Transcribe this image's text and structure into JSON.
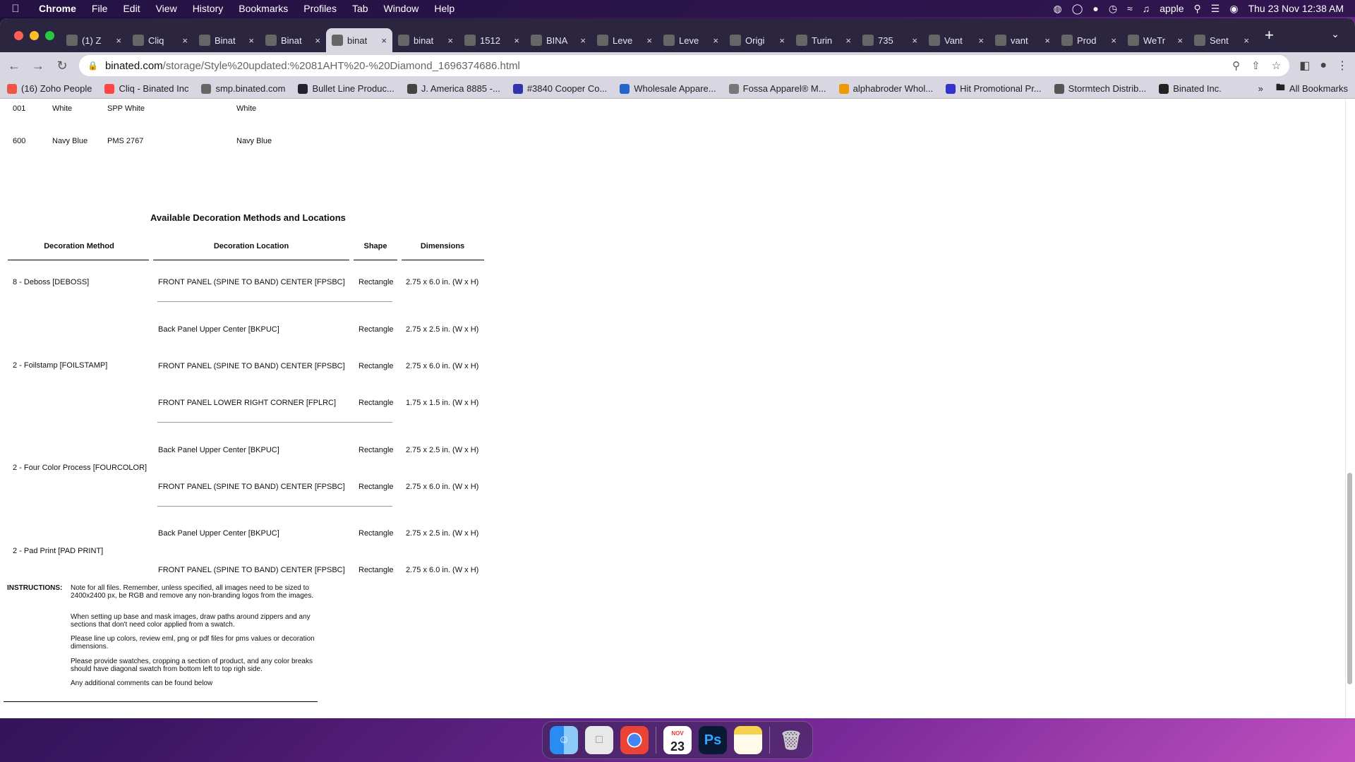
{
  "menubar": {
    "app": "Chrome",
    "items": [
      "File",
      "Edit",
      "View",
      "History",
      "Bookmarks",
      "Profiles",
      "Tab",
      "Window",
      "Help"
    ],
    "user": "apple",
    "datetime": "Thu 23 Nov  12:38 AM"
  },
  "tabs": [
    {
      "title": "(1) Z",
      "icon": "zoho"
    },
    {
      "title": "Cliq",
      "icon": "cliq"
    },
    {
      "title": "Binat",
      "icon": "b"
    },
    {
      "title": "Binat",
      "icon": "b"
    },
    {
      "title": "binat",
      "icon": "globe",
      "active": true
    },
    {
      "title": "binat",
      "icon": "globe"
    },
    {
      "title": "1512",
      "icon": "feather"
    },
    {
      "title": "BINA",
      "icon": "ssm"
    },
    {
      "title": "Leve",
      "icon": "globe"
    },
    {
      "title": "Leve",
      "icon": "v"
    },
    {
      "title": "Origi",
      "icon": "v"
    },
    {
      "title": "Turin",
      "icon": "circle"
    },
    {
      "title": "735",
      "icon": "globe"
    },
    {
      "title": "Vant",
      "icon": "v"
    },
    {
      "title": "vant",
      "icon": "globe"
    },
    {
      "title": "Prod",
      "icon": "y"
    },
    {
      "title": "WeTr",
      "icon": "w"
    },
    {
      "title": "Sent",
      "icon": "s"
    }
  ],
  "address": {
    "host": "binated.com",
    "path": "/storage/Style%20updated:%2081AHT%20-%20Diamond_1696374686.html"
  },
  "bookmarks": [
    {
      "label": "(16) Zoho People",
      "color": "#e54"
    },
    {
      "label": "Cliq - Binated Inc",
      "color": "#f44"
    },
    {
      "label": "smp.binated.com",
      "color": "#666"
    },
    {
      "label": "Bullet Line Produc...",
      "color": "#223"
    },
    {
      "label": "J. America 8885 -...",
      "color": "#444"
    },
    {
      "label": "#3840 Cooper Co...",
      "color": "#33a"
    },
    {
      "label": "Wholesale Appare...",
      "color": "#26c"
    },
    {
      "label": "Fossa Apparel® M...",
      "color": "#777"
    },
    {
      "label": "alphabroder Whol...",
      "color": "#e90"
    },
    {
      "label": "Hit Promotional Pr...",
      "color": "#33c"
    },
    {
      "label": "Stormtech Distrib...",
      "color": "#555"
    },
    {
      "label": "Binated Inc.",
      "color": "#222"
    }
  ],
  "bookmarks_more": "»",
  "all_bookmarks": "All Bookmarks",
  "colors": [
    {
      "code": "001",
      "name": "White",
      "pms": "SPP White",
      "desc": "White"
    },
    {
      "code": "600",
      "name": "Navy Blue",
      "pms": "PMS 2767",
      "desc": "Navy Blue"
    }
  ],
  "decoration": {
    "title": "Available Decoration Methods and Locations",
    "headers": {
      "method": "Decoration Method",
      "location": "Decoration Location",
      "shape": "Shape",
      "dimensions": "Dimensions"
    },
    "groups": [
      {
        "method": "8 - Deboss [DEBOSS]",
        "rows": [
          {
            "location": "FRONT PANEL (SPINE TO BAND) CENTER [FPSBC]",
            "shape": "Rectangle",
            "dim": "2.75 x 6.0 in. (W x H)"
          }
        ]
      },
      {
        "method": "2 - Foilstamp [FOILSTAMP]",
        "rows": [
          {
            "location": "Back Panel Upper Center [BKPUC]",
            "shape": "Rectangle",
            "dim": "2.75 x 2.5 in. (W x H)"
          },
          {
            "location": "FRONT PANEL (SPINE TO BAND) CENTER [FPSBC]",
            "shape": "Rectangle",
            "dim": "2.75 x 6.0 in. (W x H)"
          },
          {
            "location": "FRONT PANEL LOWER RIGHT CORNER [FPLRC]",
            "shape": "Rectangle",
            "dim": "1.75 x 1.5 in. (W x H)"
          }
        ]
      },
      {
        "method": "2 - Four Color Process [FOURCOLOR]",
        "rows": [
          {
            "location": "Back Panel Upper Center [BKPUC]",
            "shape": "Rectangle",
            "dim": "2.75 x 2.5 in. (W x H)"
          },
          {
            "location": "FRONT PANEL (SPINE TO BAND) CENTER [FPSBC]",
            "shape": "Rectangle",
            "dim": "2.75 x 6.0 in. (W x H)"
          }
        ]
      },
      {
        "method": "2 - Pad Print [PAD PRINT]",
        "rows": [
          {
            "location": "Back Panel Upper Center [BKPUC]",
            "shape": "Rectangle",
            "dim": "2.75 x 2.5 in. (W x H)"
          },
          {
            "location": "FRONT PANEL (SPINE TO BAND) CENTER [FPSBC]",
            "shape": "Rectangle",
            "dim": "2.75 x 6.0 in. (W x H)"
          }
        ]
      }
    ]
  },
  "instructions": {
    "label": "INSTRUCTIONS:",
    "paragraphs": [
      "Note for all files. Remember, unless specified, all images need to be sized to 2400x2400 px, be RGB and remove any non-branding logos from the images.",
      "When setting up base and mask images, draw paths around zippers and any sections that don't need color applied from a swatch.",
      "Please line up colors, review eml, png or pdf files for pms values or decoration dimensions.",
      "Please provide swatches, cropping a section of product, and any color breaks should have diagonal swatch from bottom left to top righ side.",
      "Any additional comments can be found below"
    ]
  },
  "dock": {
    "apps": [
      "finder",
      "files",
      "chrome",
      "calendar",
      "photoshop",
      "notes",
      "trash"
    ],
    "calendar_month": "NOV",
    "calendar_day": "23",
    "photoshop_label": "Ps"
  }
}
